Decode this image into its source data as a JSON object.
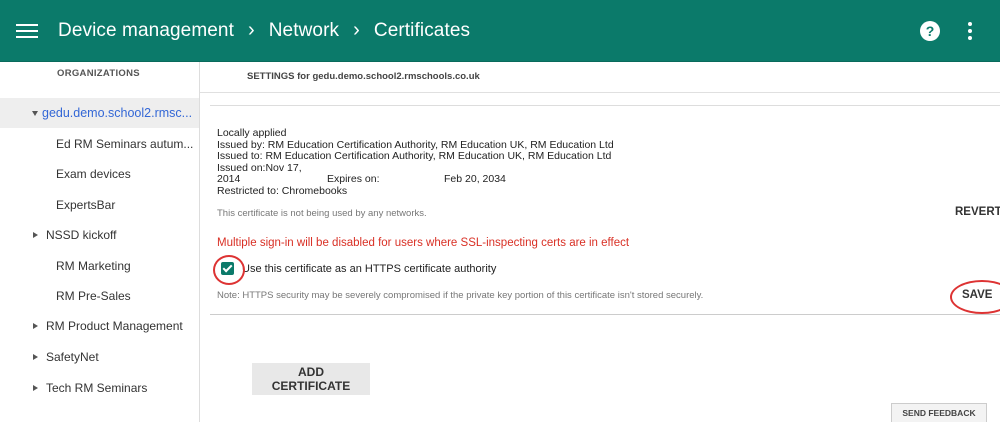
{
  "header": {
    "breadcrumbs": [
      "Device management",
      "Network",
      "Certificates"
    ],
    "separator": "›",
    "help_glyph": "?",
    "bg_color": "#0b7a6a"
  },
  "sidebar": {
    "header": "ORGANIZATIONS",
    "items": [
      {
        "label": "gedu.demo.school2.rmsc...",
        "expand": "down",
        "selected": true
      },
      {
        "label": "Ed RM Seminars autum...",
        "expand": "none"
      },
      {
        "label": "Exam devices",
        "expand": "none"
      },
      {
        "label": "ExpertsBar",
        "expand": "none"
      },
      {
        "label": "NSSD kickoff",
        "expand": "right"
      },
      {
        "label": "RM Marketing",
        "expand": "none"
      },
      {
        "label": "RM Pre-Sales",
        "expand": "none"
      },
      {
        "label": "RM Product Management",
        "expand": "right"
      },
      {
        "label": "SafetyNet",
        "expand": "right"
      },
      {
        "label": "Tech RM Seminars",
        "expand": "right"
      }
    ]
  },
  "main": {
    "settings_title": "SETTINGS for gedu.demo.school2.rmschools.co.uk",
    "cert": {
      "status": "Locally applied",
      "issued_by": "Issued by: RM Education Certification Authority, RM Education UK, RM Education Ltd",
      "issued_to": "Issued to: RM Education Certification Authority, RM Education UK, RM Education Ltd",
      "issued_on": "Issued on:Nov 17, 2014",
      "expires_label": "Expires on:",
      "expires_value": "Feb 20, 2034",
      "restricted": "Restricted to: Chromebooks"
    },
    "unused_note": "This certificate is not being used by any networks.",
    "revert_label": "REVERT",
    "warning": "Multiple sign-in will be disabled for users where SSL-inspecting certs are in effect",
    "checkbox_label": "Use this certificate as an HTTPS certificate authority",
    "checkbox_checked": true,
    "security_note": "Note: HTTPS security may be severely compromised if the private key portion of this certificate isn't stored securely.",
    "save_label": "SAVE",
    "add_certificate_label": "ADD CERTIFICATE",
    "feedback_label": "SEND FEEDBACK"
  }
}
